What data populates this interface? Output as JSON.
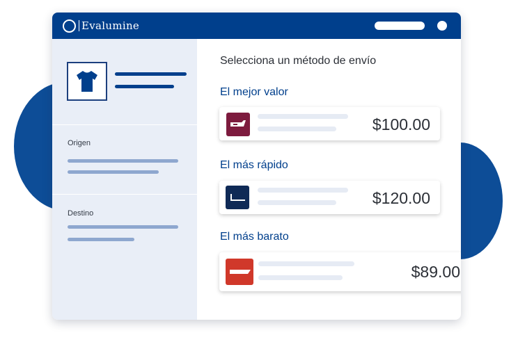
{
  "app": {
    "brand": "Evalumine"
  },
  "product": {
    "icon": "t-shirt-icon"
  },
  "sidebar": {
    "origin_label": "Origen",
    "destination_label": "Destino"
  },
  "main": {
    "title": "Selecciona un método de envío",
    "options": [
      {
        "label": "El mejor valor",
        "price": "$100.00",
        "carrier_color": "#7d1b3e",
        "carrier_icon": "truck-icon"
      },
      {
        "label": "El más rápido",
        "price": "$120.00",
        "carrier_color": "#0f2a56",
        "carrier_icon": "tray-icon"
      },
      {
        "label": "El más barato",
        "price": "$89.00",
        "carrier_color": "#d0382a",
        "carrier_icon": "stripe-icon"
      }
    ]
  },
  "colors": {
    "brand_blue": "#003f8c",
    "sidebar_bg": "#e9eef7",
    "accent_blob": "#0d4d97"
  }
}
